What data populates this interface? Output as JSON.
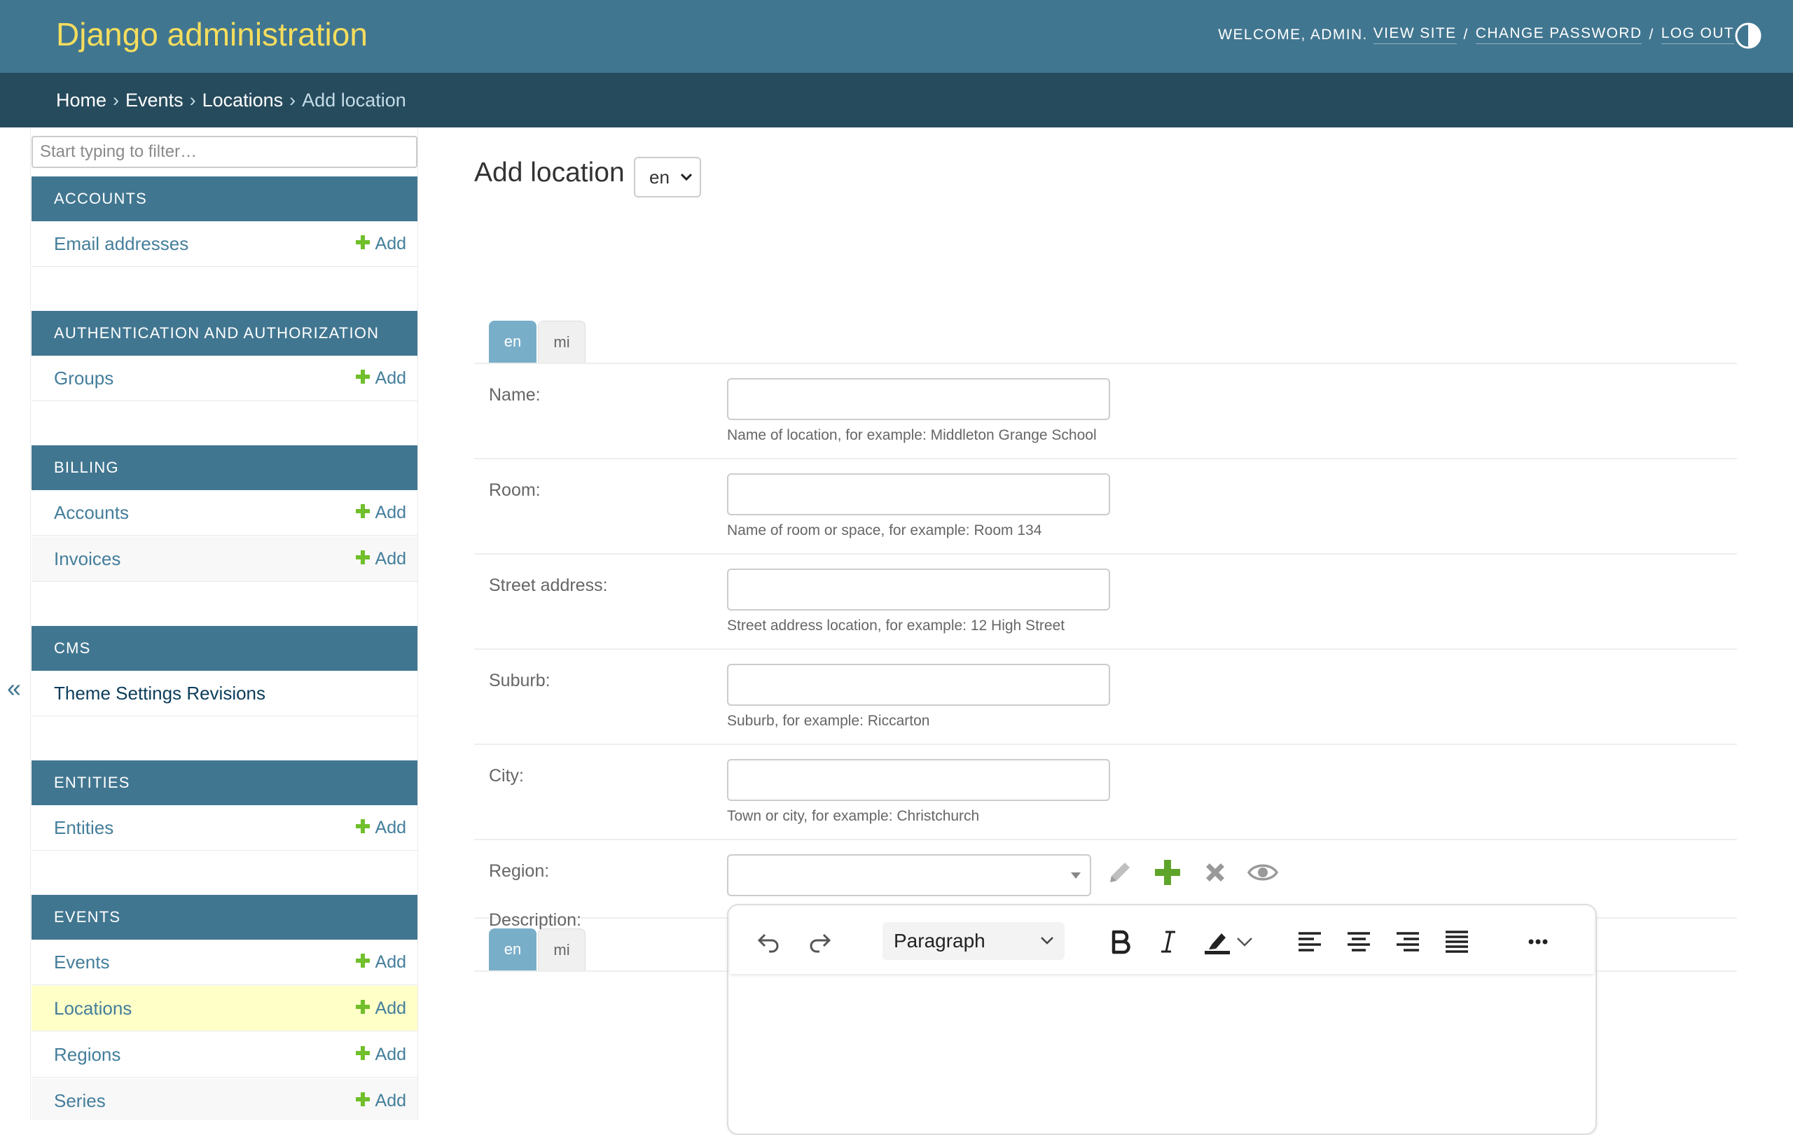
{
  "header": {
    "title": "Django administration",
    "welcome": "WELCOME, ADMIN.",
    "view_site": "VIEW SITE",
    "change_password": "CHANGE PASSWORD",
    "log_out": "LOG OUT",
    "separator": "/"
  },
  "breadcrumbs": {
    "home": "Home",
    "app": "Events",
    "model": "Locations",
    "current": "Add location",
    "separator": "›"
  },
  "sidebar": {
    "filter_placeholder": "Start typing to filter…",
    "collapse_icon": "«",
    "add_label": "Add",
    "modules": [
      {
        "title": "ACCOUNTS",
        "models": [
          {
            "name": "Email addresses"
          }
        ]
      },
      {
        "title": "AUTHENTICATION AND AUTHORIZATION",
        "models": [
          {
            "name": "Groups"
          }
        ]
      },
      {
        "title": "BILLING",
        "models": [
          {
            "name": "Accounts"
          },
          {
            "name": "Invoices"
          }
        ]
      },
      {
        "title": "CMS",
        "models": [
          {
            "name": "Theme Settings Revisions"
          }
        ]
      },
      {
        "title": "ENTITIES",
        "models": [
          {
            "name": "Entities"
          }
        ]
      },
      {
        "title": "EVENTS",
        "models": [
          {
            "name": "Events"
          },
          {
            "name": "Locations",
            "current": true
          },
          {
            "name": "Regions"
          },
          {
            "name": "Series"
          }
        ]
      }
    ]
  },
  "main": {
    "title": "Add location",
    "language_select": "en",
    "tabs": [
      {
        "label": "en",
        "active": true
      },
      {
        "label": "mi",
        "active": false
      }
    ],
    "fields": {
      "name": {
        "label": "Name:",
        "value": "",
        "help": "Name of location, for example: Middleton Grange School"
      },
      "room": {
        "label": "Room:",
        "value": "",
        "help": "Name of room or space, for example: Room 134"
      },
      "street_address": {
        "label": "Street address:",
        "value": "",
        "help": "Street address location, for example: 12 High Street"
      },
      "suburb": {
        "label": "Suburb:",
        "value": "",
        "help": "Suburb, for example: Riccarton"
      },
      "city": {
        "label": "City:",
        "value": "",
        "help": "Town or city, for example: Christchurch"
      },
      "region": {
        "label": "Region:",
        "value": ""
      },
      "description": {
        "label": "Description:"
      }
    },
    "editor": {
      "block_format": "Paragraph",
      "toolbar_icons": [
        "undo-icon",
        "redo-icon",
        "bold-icon",
        "italic-icon",
        "highlight-icon",
        "align-left-icon",
        "align-center-icon",
        "align-right-icon",
        "align-justify-icon",
        "more-icon"
      ]
    }
  },
  "colors": {
    "header_bg": "#417690",
    "breadcrumbs_bg": "#264b5d",
    "branding": "#f5dd5d",
    "module_header_bg": "#417690",
    "link": "#447e9b",
    "current_row_bg": "#ffffc8",
    "add_icon": "#70bf2b",
    "tab_active_bg": "#79aec8"
  }
}
